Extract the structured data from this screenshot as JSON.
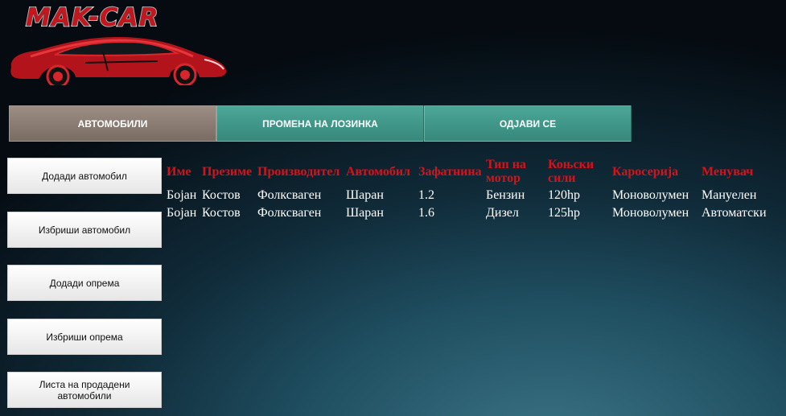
{
  "logo": {
    "text": "MAK-CAR",
    "colors": {
      "red": "#c3171f",
      "outline": "#ffffff"
    }
  },
  "topnav": {
    "tabs": [
      {
        "label": "АВТОМОБИЛИ",
        "active": true
      },
      {
        "label": "ПРОМЕНА НА ЛОЗИНКА",
        "active": false
      },
      {
        "label": "ОДЈАВИ СЕ",
        "active": false
      }
    ],
    "colors": {
      "active": "#8a7c72",
      "normal": "#43998b"
    }
  },
  "sidebar": {
    "buttons": [
      {
        "label": "Додади автомобил"
      },
      {
        "label": "Избриши автомобил"
      },
      {
        "label": "Додади опрема"
      },
      {
        "label": "Избриши опрема"
      },
      {
        "label": "Листа на продадени автомобили"
      }
    ]
  },
  "table": {
    "headers": [
      "Име",
      "Презиме",
      "Производител",
      "Автомобил",
      "Зафатнина",
      "Тип на мотор",
      "Коњски сили",
      "Каросерија",
      "Менувач"
    ],
    "rows": [
      [
        "Бојан",
        "Костов",
        "Фолксваген",
        "Шаран",
        "1.2",
        "Бензин",
        "120hp",
        "Моноволумен",
        "Мануелен"
      ],
      [
        "Бојан",
        "Костов",
        "Фолксваген",
        "Шаран",
        "1.6",
        "Дизел",
        "125hp",
        "Моноволумен",
        "Автоматски"
      ]
    ],
    "colors": {
      "header": "#d6121b",
      "cell": "#ffffff"
    }
  }
}
